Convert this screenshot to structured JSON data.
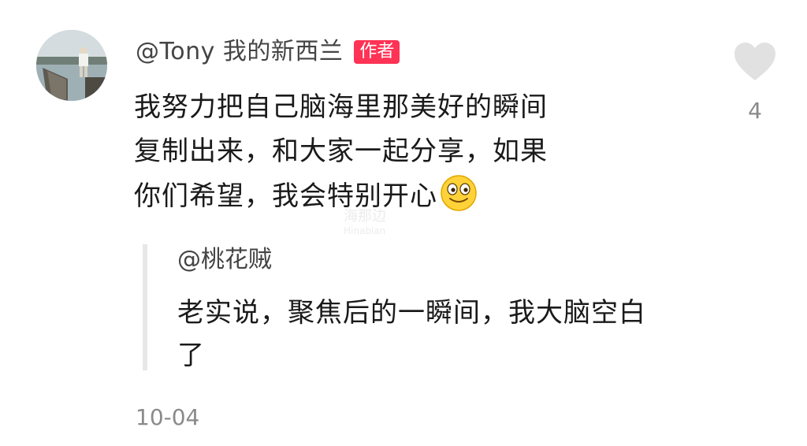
{
  "comment": {
    "avatar_icon": "avatar-photo-pier",
    "username": "@Tony 我的新西兰",
    "author_badge": "作者",
    "body_lines": [
      "我努力把自己脑海里那美好的瞬间",
      "复制出来，和大家一起分享，如果",
      "你们希望，我会特别开心"
    ],
    "emoji_icon": "smiley-emoji",
    "like_icon": "heart-icon",
    "like_count": "4",
    "timestamp": "10-04"
  },
  "reply": {
    "username": "@桃花贼",
    "text_lines": [
      "老实说，聚焦后的一瞬间，我大脑空白",
      "了"
    ]
  },
  "watermark": {
    "main": "海那边",
    "sub": "Hinabian"
  },
  "colors": {
    "badge": "#ff3355",
    "text": "#1a1a1a",
    "muted": "#8a8a8a",
    "reply_bar": "#e7e7e7"
  }
}
